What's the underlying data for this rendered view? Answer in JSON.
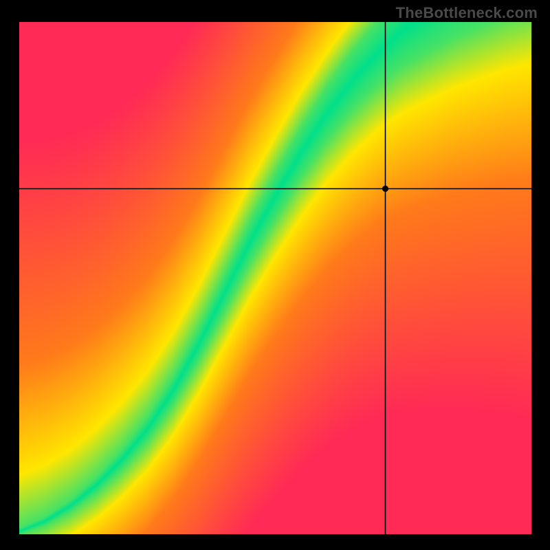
{
  "watermark": "TheBottleneck.com",
  "colors": {
    "red": "#ff2a55",
    "orange": "#ff7a1a",
    "yellow": "#ffe600",
    "green": "#00e08a",
    "crosshair": "#000000"
  },
  "chart_data": {
    "type": "heatmap",
    "title": "",
    "xlabel": "",
    "ylabel": "",
    "xlim": [
      0,
      1
    ],
    "ylim": [
      0,
      1
    ],
    "grid": false,
    "legend": false,
    "crosshair": {
      "x": 0.715,
      "y": 0.675
    },
    "green_ridge": {
      "description": "center Y of the optimal (green) band as fraction of height, keyed by X fraction",
      "points": [
        [
          0.0,
          0.005
        ],
        [
          0.05,
          0.025
        ],
        [
          0.1,
          0.055
        ],
        [
          0.15,
          0.095
        ],
        [
          0.2,
          0.145
        ],
        [
          0.25,
          0.205
        ],
        [
          0.3,
          0.28
        ],
        [
          0.35,
          0.37
        ],
        [
          0.4,
          0.47
        ],
        [
          0.45,
          0.57
        ],
        [
          0.5,
          0.66
        ],
        [
          0.55,
          0.745
        ],
        [
          0.6,
          0.82
        ],
        [
          0.65,
          0.885
        ],
        [
          0.7,
          0.94
        ],
        [
          0.75,
          0.985
        ],
        [
          0.8,
          1.02
        ],
        [
          0.85,
          1.055
        ],
        [
          0.9,
          1.085
        ],
        [
          0.95,
          1.115
        ],
        [
          1.0,
          1.14
        ]
      ],
      "half_width": {
        "description": "half-thickness of green band as fraction of height, keyed by X fraction",
        "points": [
          [
            0.0,
            0.006
          ],
          [
            0.1,
            0.012
          ],
          [
            0.2,
            0.02
          ],
          [
            0.3,
            0.028
          ],
          [
            0.4,
            0.036
          ],
          [
            0.5,
            0.044
          ],
          [
            0.6,
            0.052
          ],
          [
            0.7,
            0.062
          ],
          [
            0.8,
            0.076
          ],
          [
            0.9,
            0.092
          ],
          [
            1.0,
            0.11
          ]
        ]
      }
    }
  }
}
